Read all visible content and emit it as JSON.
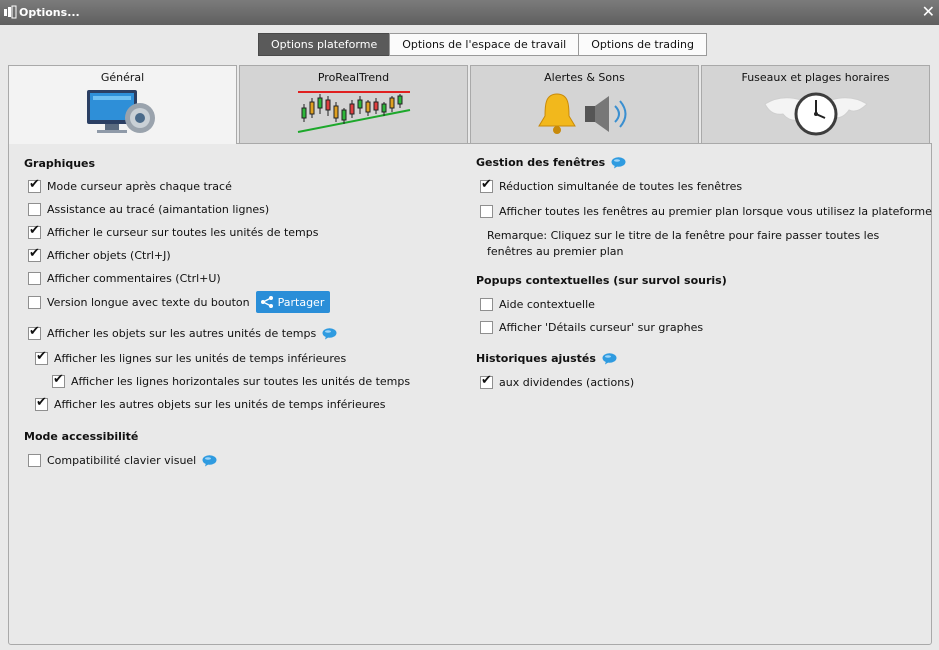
{
  "window": {
    "title": "Options...",
    "close_label": "✕"
  },
  "top_tabs": [
    {
      "label": "Options plateforme",
      "active": true
    },
    {
      "label": "Options de l'espace de travail",
      "active": false
    },
    {
      "label": "Options de trading",
      "active": false
    }
  ],
  "category_tabs": [
    {
      "label": "Général",
      "icon": "monitor-gear-icon",
      "active": true
    },
    {
      "label": "ProRealTrend",
      "icon": "candlestick-trend-icon",
      "active": false
    },
    {
      "label": "Alertes & Sons",
      "icon": "bell-speaker-icon",
      "active": false
    },
    {
      "label": "Fuseaux et plages horaires",
      "icon": "world-clock-icon",
      "active": false
    }
  ],
  "left": {
    "graphiques_title": "Graphiques",
    "options": [
      {
        "label": "Mode curseur après chaque tracé",
        "checked": true
      },
      {
        "label": "Assistance au tracé (aimantation lignes)",
        "checked": false
      },
      {
        "label": "Afficher le curseur sur toutes les unités de temps",
        "checked": true
      },
      {
        "label": "Afficher objets (Ctrl+J)",
        "checked": true
      },
      {
        "label": "Afficher commentaires (Ctrl+U)",
        "checked": false
      },
      {
        "label": "Version longue avec texte du bouton",
        "checked": false
      },
      {
        "label": "Afficher les objets sur les autres unités de temps",
        "checked": true
      },
      {
        "label": "Afficher les lignes sur les unités de temps inférieures",
        "checked": true
      },
      {
        "label": "Afficher les lignes horizontales sur toutes les unités de temps",
        "checked": true
      },
      {
        "label": "Afficher les autres objets sur les unités de temps inférieures",
        "checked": true
      }
    ],
    "share_label": "Partager",
    "accessibility_title": "Mode accessibilité",
    "accessibility_option": {
      "label": "Compatibilité clavier visuel",
      "checked": false
    }
  },
  "right": {
    "windows_title": "Gestion des fenêtres",
    "windows_options": [
      {
        "label": "Réduction simultanée de toutes les fenêtres",
        "checked": true
      },
      {
        "label": "Afficher toutes les fenêtres au premier plan lorsque vous utilisez la plateforme",
        "checked": false
      }
    ],
    "remark": "Remarque: Cliquez sur le titre de la fenêtre pour faire passer toutes les fenêtres au premier plan",
    "popups_title": "Popups contextuelles (sur survol souris)",
    "popups_options": [
      {
        "label": "Aide contextuelle",
        "checked": false
      },
      {
        "label": "Afficher 'Détails curseur' sur graphes",
        "checked": false
      }
    ],
    "history_title": "Historiques ajustés",
    "history_options": [
      {
        "label": "aux dividendes (actions)",
        "checked": true
      }
    ]
  },
  "colors": {
    "share_button": "#2a8ed8",
    "info_bubble": "#2f9be0",
    "active_segment": "#5a5a5a"
  }
}
